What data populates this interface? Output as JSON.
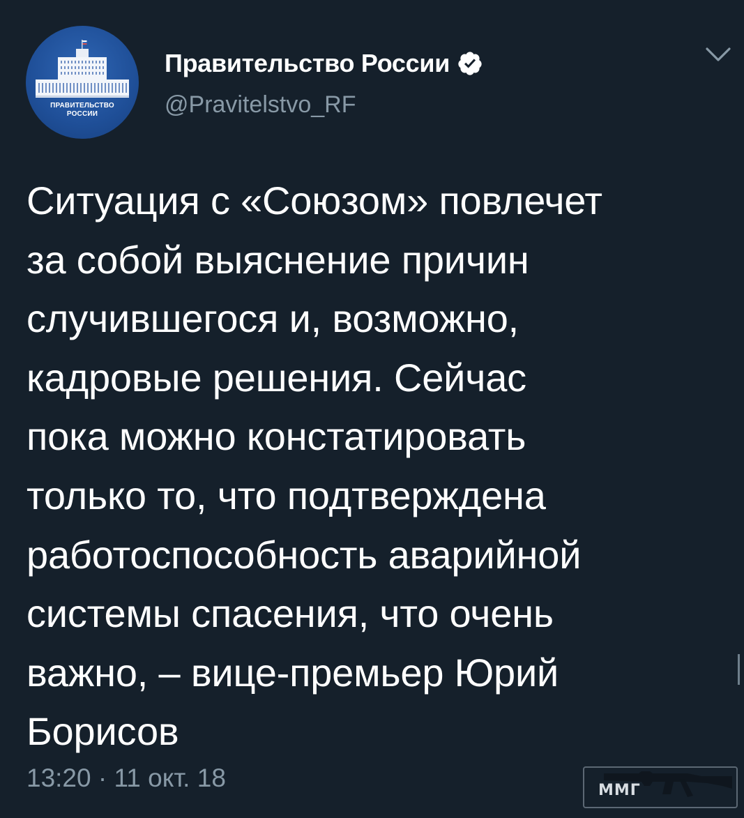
{
  "author": {
    "display_name": "Правительство России",
    "handle": "@Pravitelstvo_RF",
    "avatar_caption_line1": "ПРАВИТЕЛЬСТВО",
    "avatar_caption_line2": "РОССИИ",
    "verified": true
  },
  "tweet": {
    "text": "Ситуация с «Союзом» повлечет\nза собой выяснение причин\nслучившегося и, возможно,\nкадровые решения. Сейчас\nпока можно констатировать\nтолько то, что подтверждена\nработоспособность аварийной\nсистемы спасения, что очень\nважно, – вице-премьер Юрий\nБорисов",
    "timestamp": "13:20 · 11 окт. 18"
  },
  "watermark": {
    "label": "ММГ"
  },
  "icons": {
    "verified": "verified-badge-icon",
    "menu": "chevron-down-icon",
    "watermark": "rifle-logo"
  },
  "colors": {
    "background": "#15202b",
    "text": "#ffffff",
    "secondary": "#8899a6",
    "avatar_blue": "#1f4f98"
  }
}
